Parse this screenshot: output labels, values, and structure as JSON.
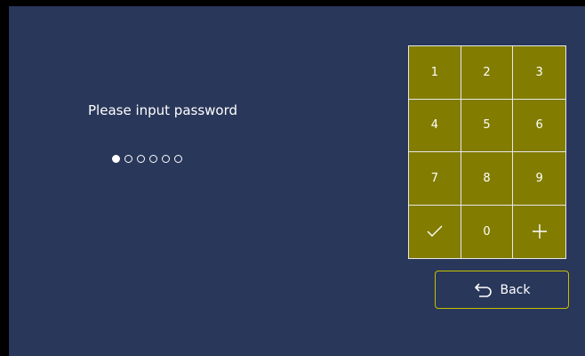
{
  "prompt": {
    "text": "Please input password"
  },
  "password": {
    "length": 6,
    "entered": 1
  },
  "keypad": {
    "keys": [
      "1",
      "2",
      "3",
      "4",
      "5",
      "6",
      "7",
      "8",
      "9",
      "check-icon",
      "0",
      "plus-icon"
    ],
    "key_color": "#827d00",
    "border_color": "#e8e8e8"
  },
  "back": {
    "label": "Back",
    "icon": "undo-arrow-icon",
    "border_color": "#c8c000"
  },
  "colors": {
    "background": "#29375a",
    "frame": "#000000",
    "text": "#ffffff"
  }
}
